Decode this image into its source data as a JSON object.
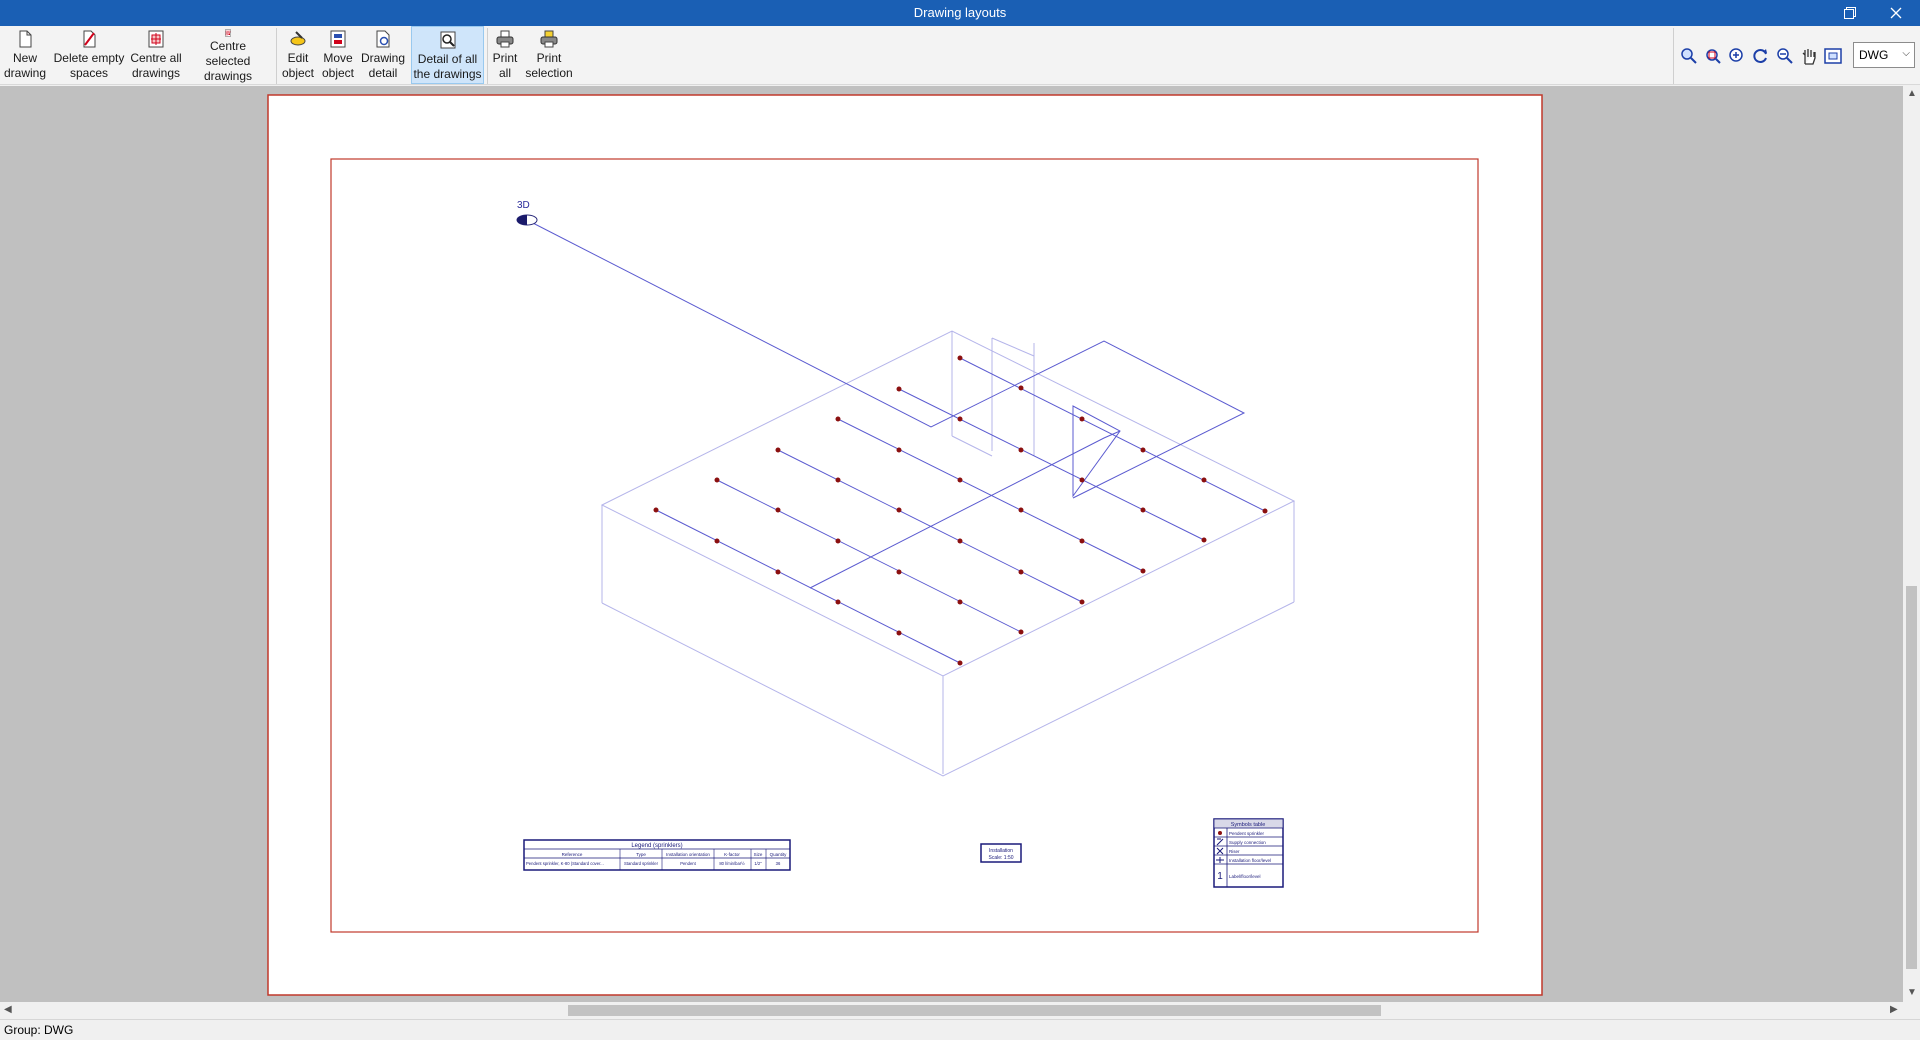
{
  "window": {
    "title": "Drawing layouts"
  },
  "toolbar": {
    "new_drawing": "New\ndrawing",
    "delete_empty": "Delete empty\nspaces",
    "centre_all": "Centre all\ndrawings",
    "centre_selected": "Centre selected\ndrawings",
    "edit_object": "Edit\nobject",
    "move_object": "Move\nobject",
    "drawing_detail": "Drawing\ndetail",
    "detail_all": "Detail of all\nthe drawings",
    "print_all": "Print\nall",
    "print_selection": "Print\nselection"
  },
  "group_select": {
    "value": "DWG"
  },
  "drawing": {
    "view_label": "3D",
    "legend_title": "Legend (sprinklers)",
    "legend_headers": [
      "Reference",
      "Type",
      "Installation orientation",
      "K-factor",
      "Size",
      "Quantity"
    ],
    "legend_row": [
      "Pendent sprinkler, K-80 (Standard cover...",
      "Standard sprinkler",
      "Pendent",
      "80 l/min/bar½",
      "1/2\"",
      "36"
    ],
    "title_block": [
      "Installation",
      "Scale: 1:50"
    ],
    "symbols_title": "Symbols table",
    "symbols": [
      "Pendent sprinkler",
      "Supply connection",
      "Riser",
      "Installation floor/level",
      "Label/floor/level"
    ]
  },
  "status": {
    "text": "Group: DWG"
  }
}
